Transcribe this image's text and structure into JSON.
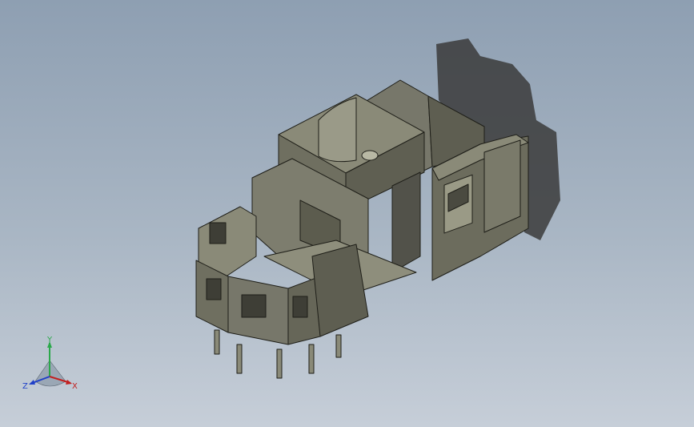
{
  "viewport": {
    "background_top": "#8e9fb2",
    "background_bottom": "#c6ced8",
    "model_color": "#6a6a58",
    "shadow_color": "#3b3b3b"
  },
  "triad": {
    "x_label": "X",
    "y_label": "Y",
    "z_label": "Z",
    "x_color": "#c22020",
    "y_color": "#2aa84a",
    "z_color": "#2040c8"
  }
}
